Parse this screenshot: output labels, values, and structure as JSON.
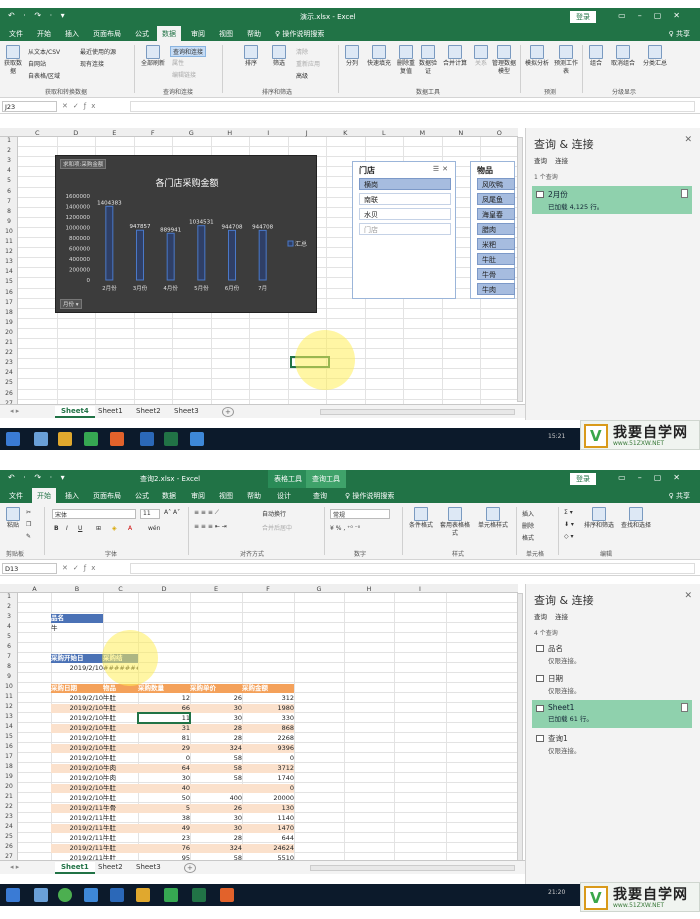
{
  "s1": {
    "quick_access": "↶ · ↷ · ▾",
    "doc_title": "演示.xlsx - Excel",
    "login": "登录",
    "share": "♀ 共享",
    "tabs": [
      "文件",
      "开始",
      "插入",
      "页面布局",
      "公式",
      "数据",
      "审阅",
      "视图",
      "帮助",
      "♀ 操作说明搜索"
    ],
    "active_tab": "数据",
    "ribbon": {
      "get_data": "获取数据",
      "from_text_csv": "从文本/CSV",
      "recent_sources": "最近使用的源",
      "from_web": "自网站",
      "existing_connections": "现有连接",
      "from_table": "自表格/区域",
      "group_get": "获取和转换数据",
      "refresh_all": "全部刷新",
      "queries_connections": "查询和连接",
      "properties": "属性",
      "edit_links": "编辑链接",
      "group_queries": "查询和连接",
      "sort": "排序",
      "filter": "筛选",
      "clear": "清除",
      "reapply": "重新应用",
      "advanced": "高级",
      "group_sort": "排序和筛选",
      "split": "分列",
      "flash_fill": "快速填充",
      "remove_dup": "删除重复值",
      "data_validation": "数据验证",
      "consolidate": "合并计算",
      "relationships": "关系",
      "manage_model": "管理数据模型",
      "group_tools": "数据工具",
      "what_if": "模拟分析",
      "forecast_sheet": "预测工作表",
      "group_forecast": "预测",
      "group": "组合",
      "ungroup": "取消组合",
      "subtotal": "分类汇总",
      "group_outline": "分级显示"
    },
    "name_box": "J23",
    "columns": [
      "C",
      "D",
      "E",
      "F",
      "G",
      "H",
      "I",
      "J",
      "K",
      "L",
      "M",
      "N",
      "O"
    ],
    "rows": [
      "1",
      "2",
      "3",
      "4",
      "5",
      "6",
      "7",
      "8",
      "9",
      "10",
      "11",
      "12",
      "13",
      "14",
      "15",
      "16",
      "17",
      "18",
      "19",
      "20",
      "21",
      "22",
      "23",
      "24",
      "25",
      "26",
      "27"
    ],
    "sheets": [
      "Sheet4",
      "Sheet1",
      "Sheet2",
      "Sheet3"
    ],
    "chart_chip": "求和项:采购金额",
    "month_filter": "月份 ▾",
    "chart_legend": "汇总",
    "chart_data": {
      "type": "bar",
      "title": "各门店采购金额",
      "categories": [
        "2月份",
        "3月份",
        "4月份",
        "5月份",
        "6月份",
        "7月"
      ],
      "series": [
        {
          "name": "汇总",
          "values": [
            1404383,
            947857,
            889941,
            1034531,
            944708,
            944708
          ]
        }
      ],
      "data_labels": [
        "1404383",
        "947857",
        "889941",
        "1034531",
        "944708",
        "944708"
      ],
      "y_ticks": [
        "1600000",
        "1400000",
        "1200000",
        "1000000",
        "800000",
        "600000",
        "400000",
        "200000",
        "0"
      ],
      "ylim": [
        0,
        1600000
      ],
      "legend": "right"
    },
    "slicer_store": {
      "title": "门店",
      "items": [
        "横岗",
        "南联",
        "水贝",
        "门店"
      ]
    },
    "slicer_goods": {
      "title": "物品",
      "items": [
        "风吹鸭",
        "凤尾鱼",
        "海皇春",
        "腊肉",
        "米粑",
        "牛肚",
        "牛骨",
        "牛肉"
      ]
    },
    "pane": {
      "title": "查询 & 连接",
      "tab_queries": "查询",
      "tab_connections": "连接",
      "count": "1 个查询",
      "queries": [
        {
          "name": "2月份",
          "status": "已加载 4,125 行。"
        }
      ]
    },
    "time": "15:21"
  },
  "s2": {
    "quick_access": "↶ · ↷ · ▾",
    "doc_title": "查询2.xlsx - Excel",
    "context_tools": "表格工具",
    "context_query": "查询工具",
    "login": "登录",
    "share": "♀ 共享",
    "tabs": [
      "文件",
      "开始",
      "插入",
      "页面布局",
      "公式",
      "数据",
      "审阅",
      "视图",
      "帮助",
      "设计",
      "查询",
      "♀ 操作说明搜索"
    ],
    "active_tab": "开始",
    "ribbon": {
      "paste": "粘贴",
      "group_clipboard": "剪贴板",
      "font_name": "宋体",
      "font_size": "11",
      "bold": "B",
      "italic": "I",
      "underline": "U",
      "group_font": "字体",
      "wrap": "自动换行",
      "merge": "合并后居中",
      "group_align": "对齐方式",
      "number_format": "常规",
      "group_number": "数字",
      "cond_format": "条件格式",
      "format_table": "套用表格格式",
      "cell_styles": "单元格样式",
      "group_styles": "样式",
      "insert": "插入",
      "delete": "删除",
      "format": "格式",
      "group_cells": "单元格",
      "sort_filter": "排序和筛选",
      "find_select": "查找和选择",
      "group_edit": "编辑"
    },
    "name_box": "D13",
    "columns": [
      "A",
      "B",
      "C",
      "D",
      "E",
      "F",
      "G",
      "H",
      "I"
    ],
    "rows": [
      "1",
      "2",
      "3",
      "4",
      "5",
      "6",
      "7",
      "8",
      "9",
      "10",
      "11",
      "12",
      "13",
      "14",
      "15",
      "16",
      "17",
      "18",
      "19",
      "20",
      "21",
      "22",
      "23",
      "24",
      "25",
      "26",
      "27"
    ],
    "table1": {
      "header": "品名",
      "value": "牛"
    },
    "table2": {
      "header_a": "采购开始日",
      "header_b": "采购结",
      "date": "2019/2/10",
      "value": "#######"
    },
    "main_headers": [
      "采购日期",
      "物品",
      "采购数量",
      "采购单价",
      "采购金额"
    ],
    "main_rows": [
      [
        "2019/2/10",
        "牛肚",
        "12",
        "26",
        "312"
      ],
      [
        "2019/2/10",
        "牛肚",
        "66",
        "30",
        "1980"
      ],
      [
        "2019/2/10",
        "牛肚",
        "11",
        "30",
        "330"
      ],
      [
        "2019/2/10",
        "牛肚",
        "31",
        "28",
        "868"
      ],
      [
        "2019/2/10",
        "牛肚",
        "81",
        "28",
        "2268"
      ],
      [
        "2019/2/10",
        "牛肚",
        "29",
        "324",
        "9396"
      ],
      [
        "2019/2/10",
        "牛肚",
        "0",
        "58",
        "0"
      ],
      [
        "2019/2/10",
        "牛肉",
        "64",
        "58",
        "3712"
      ],
      [
        "2019/2/10",
        "牛肉",
        "30",
        "58",
        "1740"
      ],
      [
        "2019/2/10",
        "牛肚",
        "40",
        "",
        "0"
      ],
      [
        "2019/2/10",
        "牛肚",
        "50",
        "400",
        "20000"
      ],
      [
        "2019/2/11",
        "牛骨",
        "5",
        "26",
        "130"
      ],
      [
        "2019/2/11",
        "牛肚",
        "38",
        "30",
        "1140"
      ],
      [
        "2019/2/11",
        "牛肚",
        "49",
        "30",
        "1470"
      ],
      [
        "2019/2/11",
        "牛肚",
        "23",
        "28",
        "644"
      ],
      [
        "2019/2/11",
        "牛肚",
        "76",
        "324",
        "24624"
      ],
      [
        "2019/2/11",
        "牛肚",
        "95",
        "58",
        "5510"
      ]
    ],
    "sheets": [
      "Sheet1",
      "Sheet2",
      "Sheet3"
    ],
    "pane": {
      "title": "查询 & 连接",
      "tab_queries": "查询",
      "tab_connections": "连接",
      "count": "4 个查询",
      "queries": [
        {
          "name": "品名",
          "status": "仅限连接。"
        },
        {
          "name": "日期",
          "status": "仅限连接。"
        },
        {
          "name": "Sheet1",
          "status": "已加载 61 行。"
        },
        {
          "name": "查询1",
          "status": "仅限连接。"
        }
      ]
    },
    "time": "21:20"
  },
  "watermark": {
    "big": "我要自学网",
    "small": "www.51ZXW.NET",
    "logo": "V"
  },
  "colors": {
    "excel_green": "#217346",
    "pane_selected": "#8fd1ad",
    "table_orange": "#f4a15a",
    "band_orange": "#fbe1cc",
    "slicer_blue": "#a6bcdf",
    "bar_blue": "#4a78c8"
  }
}
